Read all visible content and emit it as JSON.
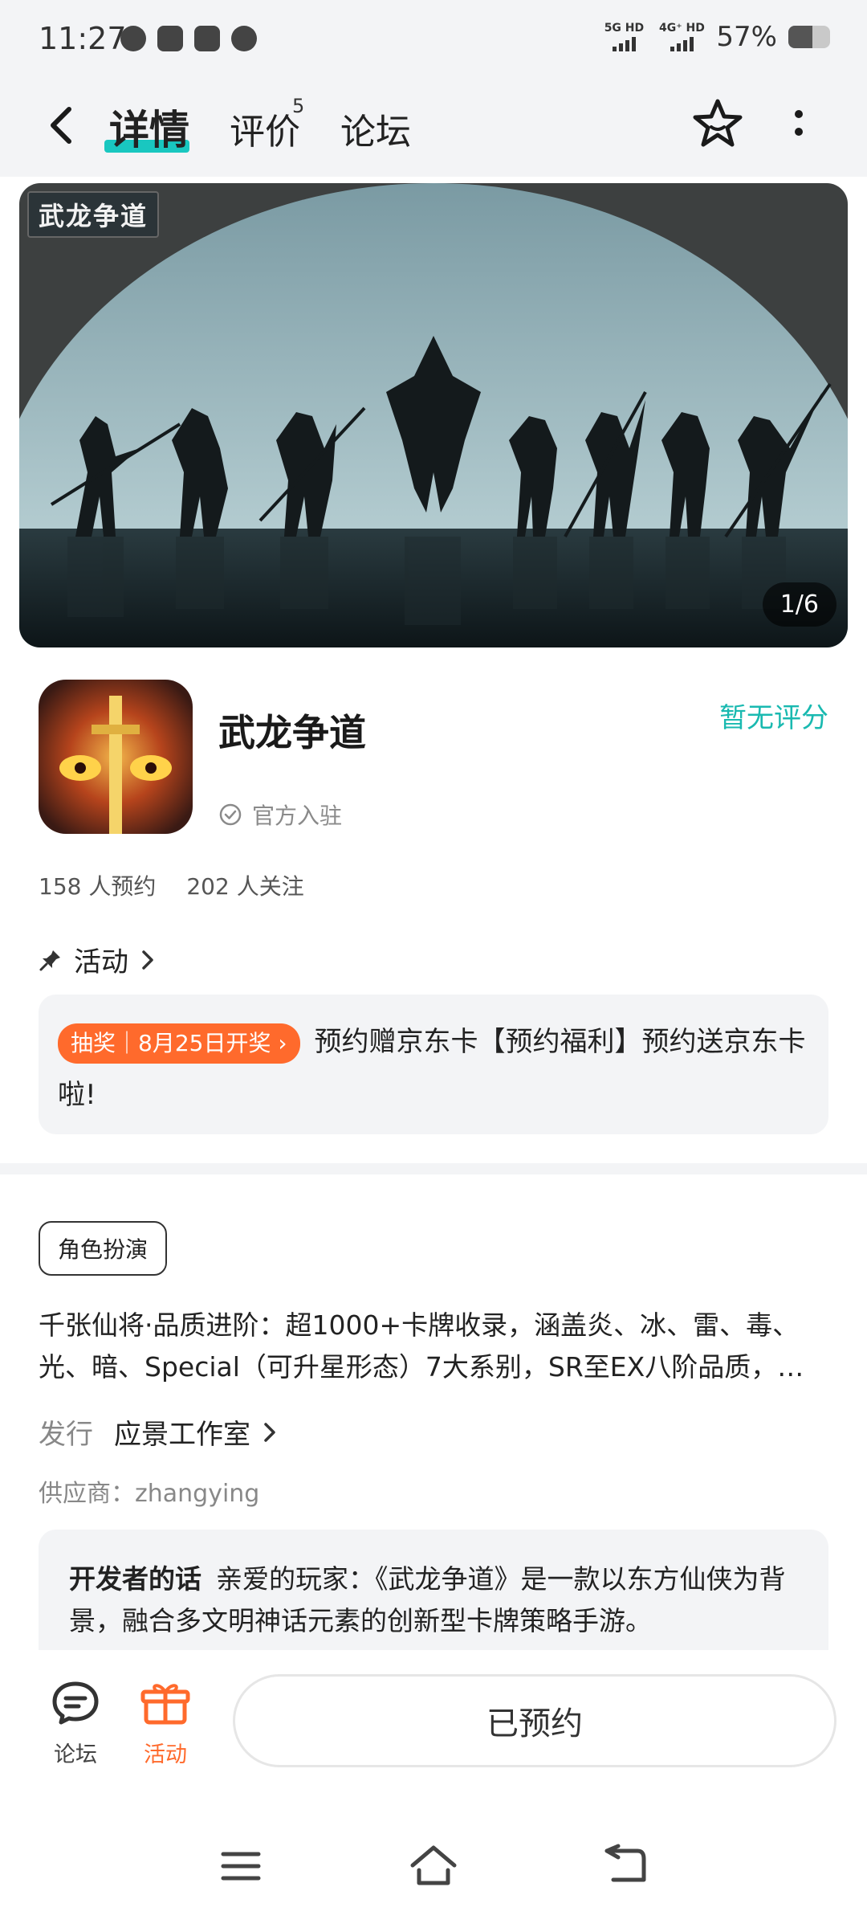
{
  "status_bar": {
    "time": "11:27",
    "signal_1": "5G HD",
    "signal_2": "4G⁺ HD",
    "battery_percent": "57%",
    "battery_level": 0.57
  },
  "header": {
    "tabs": [
      {
        "label": "详情",
        "active": true
      },
      {
        "label": "评价",
        "badge": "5"
      },
      {
        "label": "论坛"
      }
    ]
  },
  "banner": {
    "logo_text": "武龙争道",
    "counter": "1/6"
  },
  "app": {
    "name": "武龙争道",
    "rating": "暂无评分",
    "verified": "官方入驻",
    "reservations": "158 人预约",
    "followers": "202 人关注"
  },
  "activity": {
    "heading": "活动",
    "tag": "抽奖｜8月25日开奖 ›",
    "text": "预约赠京东卡【预约福利】预约送京东卡啦!"
  },
  "details": {
    "genre": "角色扮演",
    "description": "千张仙将·品质进阶：超1000+卡牌收录，涵盖炎、冰、雷、毒、光、暗、Special（可升星形态）7大系别，SR至EX八阶品质，…",
    "publisher_label": "发行",
    "publisher_name": "应景工作室",
    "supplier": "供应商：zhangying",
    "dev_label": "开发者的话",
    "dev_text": "亲爱的玩家：《武龙争道》是一款以东方仙侠为背景，融合多文明神话元素的创新型卡牌策略手游。"
  },
  "bottom_bar": {
    "forum_label": "论坛",
    "activity_label": "活动",
    "reserve_button": "已预约"
  },
  "colors": {
    "accent_teal": "#19c7c0",
    "accent_orange": "#ff6a2c"
  }
}
